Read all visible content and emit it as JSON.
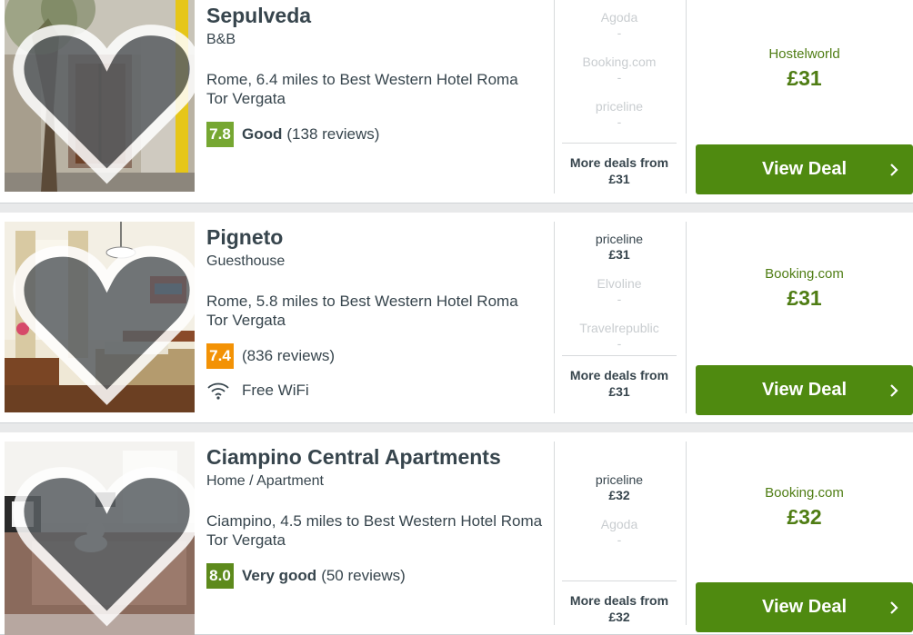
{
  "colors": {
    "deal_green": "#4f8a10",
    "price_green": "#4f7d14",
    "score_green": "#76a732",
    "score_orange": "#f39205",
    "score_dark_green": "#5d8a1c"
  },
  "hotels": [
    {
      "name": "Sepulveda",
      "type": "B&B",
      "location": "Rome, 6.4 miles to Best Western Hotel Roma Tor Vergata",
      "rating": {
        "score": "7.8",
        "label": "Good",
        "reviews": "(138 reviews)"
      },
      "deals": [
        {
          "provider": "Agoda",
          "price": "-"
        },
        {
          "provider": "Booking.com",
          "price": "-"
        },
        {
          "provider": "priceline",
          "price": "-"
        }
      ],
      "more_deals": {
        "label": "More deals from",
        "price": "£31"
      },
      "best": {
        "provider": "Hostelworld",
        "price": "£31"
      },
      "button": "View Deal"
    },
    {
      "name": "Pigneto",
      "type": "Guesthouse",
      "location": "Rome, 5.8 miles to Best Western Hotel Roma Tor Vergata",
      "rating": {
        "score": "7.4",
        "label": "",
        "reviews": "(836 reviews)"
      },
      "amenity": {
        "icon": "wifi-icon",
        "label": "Free WiFi"
      },
      "deals": [
        {
          "provider": "priceline",
          "price": "£31"
        },
        {
          "provider": "Elvoline",
          "price": "-"
        },
        {
          "provider": "Travelrepublic",
          "price": "-"
        }
      ],
      "more_deals": {
        "label": "More deals from",
        "price": "£31"
      },
      "best": {
        "provider": "Booking.com",
        "price": "£31"
      },
      "button": "View Deal"
    },
    {
      "name": "Ciampino Central Apartments",
      "type": "Home / Apartment",
      "location": "Ciampino, 4.5 miles to Best Western Hotel Roma Tor Vergata",
      "rating": {
        "score": "8.0",
        "label": "Very good",
        "reviews": "(50 reviews)"
      },
      "deals": [
        {
          "provider": "priceline",
          "price": "£32"
        },
        {
          "provider": "Agoda",
          "price": "-"
        }
      ],
      "more_deals": {
        "label": "More deals from",
        "price": "£32"
      },
      "best": {
        "provider": "Booking.com",
        "price": "£32"
      },
      "button": "View Deal"
    }
  ]
}
